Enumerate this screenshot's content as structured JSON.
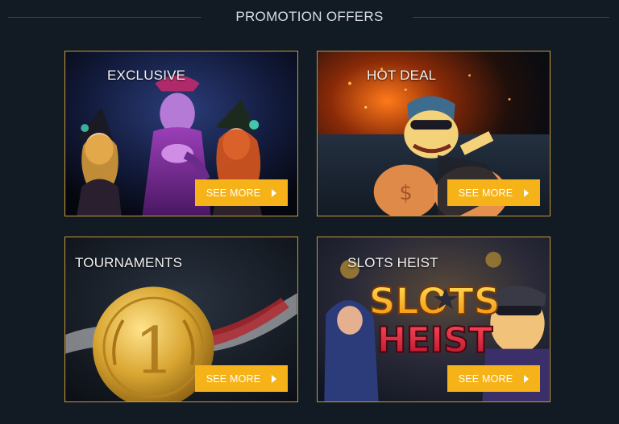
{
  "header": {
    "title": "PROMOTION OFFERS"
  },
  "cards": [
    {
      "label": "EXCLUSIVE",
      "button": "SEE MORE",
      "art": "witches-illustration"
    },
    {
      "label": "HOT DEAL",
      "button": "SEE MORE",
      "art": "robber-with-money-bags-illustration"
    },
    {
      "label": "TOURNAMENTS",
      "button": "SEE MORE",
      "art": "gold-medal-illustration"
    },
    {
      "label": "SLOTS HEIST",
      "button": "SEE MORE",
      "art": "slots-heist-illustration",
      "logo_lines": [
        "SLOTS",
        "HEIST"
      ]
    }
  ],
  "colors": {
    "background": "#121a24",
    "card_border": "#c79a3a",
    "button": "#f6b319",
    "rule": "#3a434e"
  },
  "icons": {
    "button_arrow": "caret-right-icon"
  }
}
